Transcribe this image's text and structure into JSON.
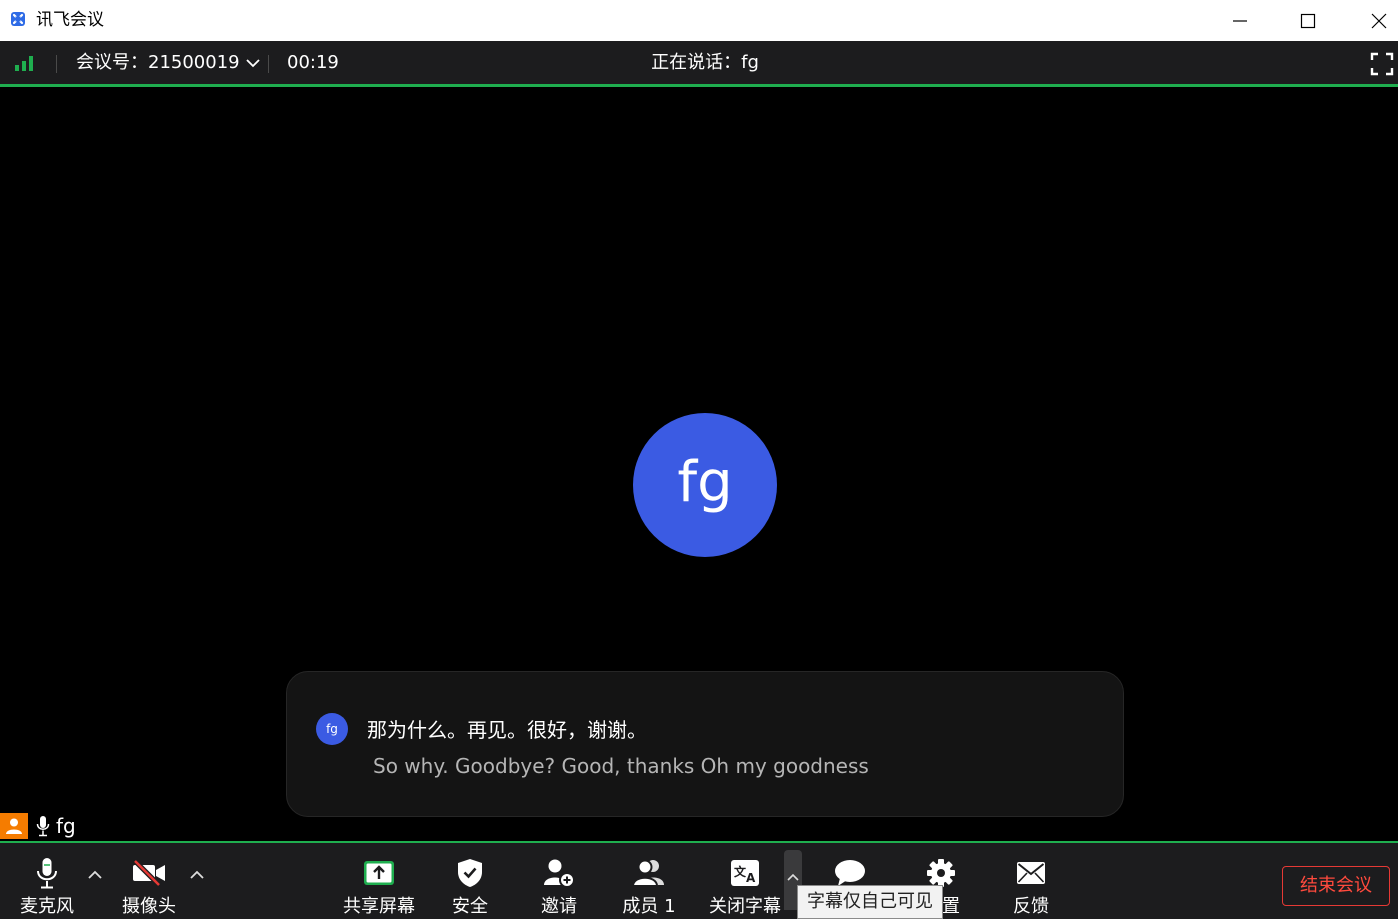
{
  "window": {
    "title": "讯飞会议"
  },
  "infobar": {
    "meeting_id": "会议号：21500019",
    "timer": "00:19",
    "speaking": "正在说话：fg"
  },
  "stage": {
    "avatar_initials": "fg",
    "caption": {
      "avatar_initials": "fg",
      "chinese_text": "那为什么。再见。很好，谢谢。",
      "english_text": "So why. Goodbye? Good, thanks Oh my goodness"
    },
    "name_tag": "fg"
  },
  "toolbar": {
    "mic_label": "麦克风",
    "camera_label": "摄像头",
    "share_label": "共享屏幕",
    "security_label": "安全",
    "invite_label": "邀请",
    "members_label": "成员 1",
    "captions_label": "关闭字幕",
    "chat_label": "",
    "settings_label": "置",
    "feedback_label": "反馈",
    "end_label": "结束会议",
    "tooltip": "字幕仅自己可见"
  },
  "colors": {
    "accent_green": "#1fae4f",
    "avatar_blue": "#3b5be3",
    "end_red": "#e53935",
    "user_orange": "#f57c00"
  }
}
